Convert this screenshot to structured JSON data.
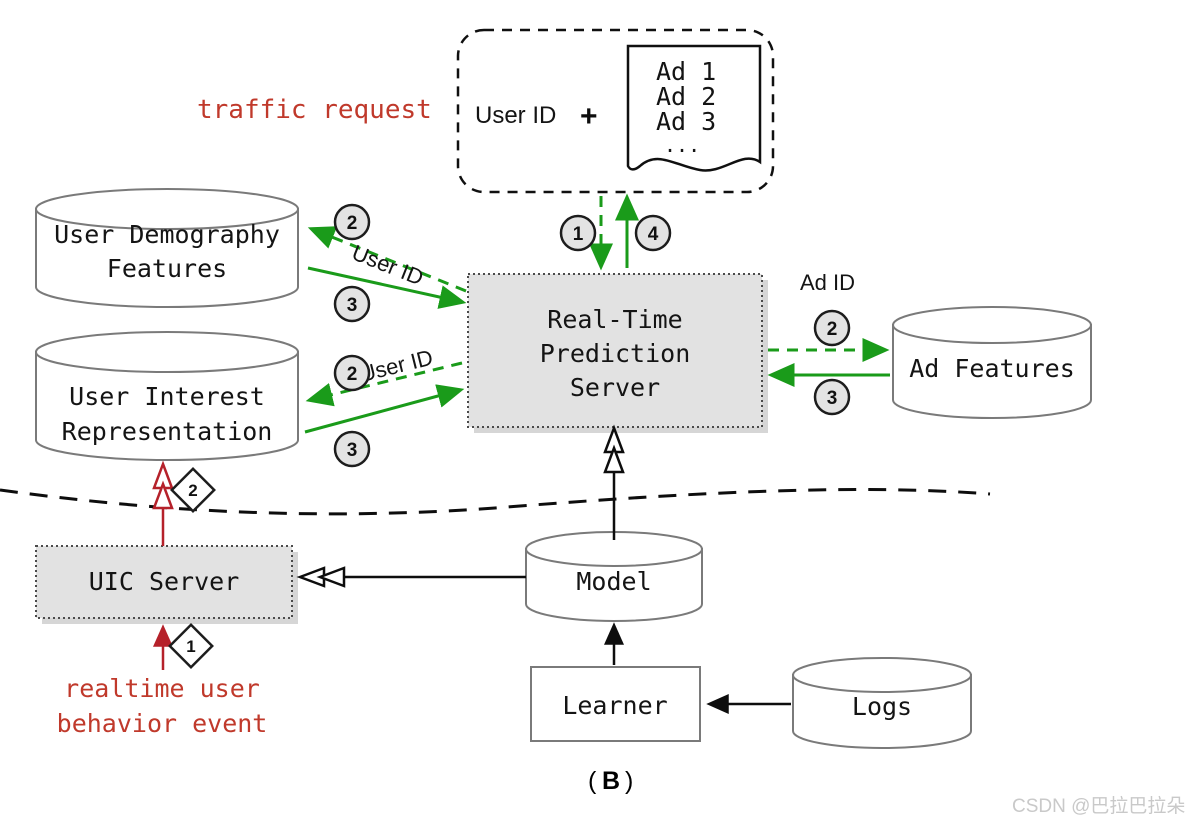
{
  "figure": {
    "caption_prefix": "(",
    "caption_letter": "B",
    "caption_suffix": ")",
    "watermark": "CSDN @巴拉巴拉朵"
  },
  "colors": {
    "green": "#1a9b1a",
    "red_text": "#c0392b",
    "red_arrow": "#b5212a",
    "black": "#0d0d0d",
    "server_fill": "#e2e2e2",
    "badge_fill": "#e3e3e3",
    "node_stroke": "#7a7a7a",
    "watermark": "#c9c9c9"
  },
  "labels": {
    "traffic_request": "traffic request",
    "realtime_event_line1": "realtime user",
    "realtime_event_line2": "behavior event",
    "user_id_top": "User ID",
    "user_id_bottom": "User ID",
    "ad_id": "Ad ID"
  },
  "request_packet": {
    "user_id_text": "User ID",
    "plus": "+",
    "ad_lines": [
      "Ad 1",
      "Ad 2",
      "Ad 3"
    ],
    "ellipsis": "..."
  },
  "nodes": {
    "user_demography": {
      "label_line1": "User Demography",
      "label_line2": "Features",
      "shape": "cylinder"
    },
    "user_interest": {
      "label_line1": "User Interest",
      "label_line2": "Representation",
      "shape": "cylinder"
    },
    "prediction_server": {
      "label_line1": "Real-Time",
      "label_line2": "Prediction",
      "label_line3": "Server",
      "shape": "shadow-box"
    },
    "ad_features": {
      "label": "Ad Features",
      "shape": "cylinder"
    },
    "uic_server": {
      "label": "UIC Server",
      "shape": "shadow-box"
    },
    "model": {
      "label": "Model",
      "shape": "cylinder"
    },
    "learner": {
      "label": "Learner",
      "shape": "box"
    },
    "logs": {
      "label": "Logs",
      "shape": "cylinder"
    }
  },
  "step_badges": {
    "demography_out": "2",
    "demography_in": "3",
    "interest_out": "2",
    "interest_in": "3",
    "request_in": "1",
    "request_out": "4",
    "adfeat_out": "2",
    "adfeat_in": "3",
    "uic_write": "2",
    "uic_event": "1"
  }
}
